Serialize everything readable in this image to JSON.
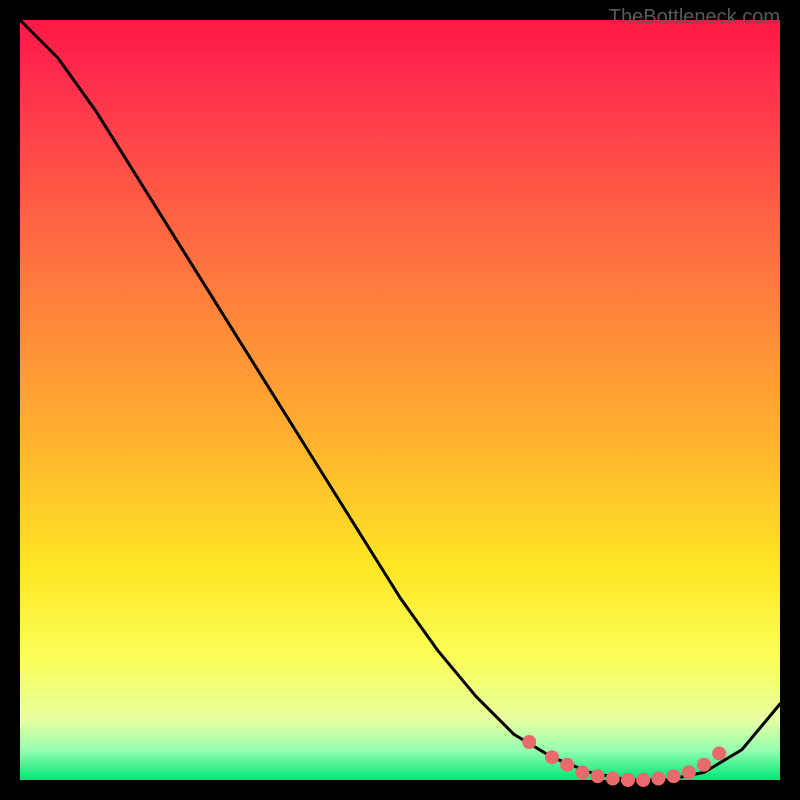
{
  "watermark": "TheBottleneck.com",
  "chart_data": {
    "type": "line",
    "title": "",
    "xlabel": "",
    "ylabel": "",
    "xlim": [
      0,
      100
    ],
    "ylim": [
      0,
      100
    ],
    "series": [
      {
        "name": "bottleneck-curve",
        "x": [
          0,
          5,
          10,
          15,
          20,
          25,
          30,
          35,
          40,
          45,
          50,
          55,
          60,
          65,
          70,
          75,
          80,
          85,
          90,
          95,
          100
        ],
        "values": [
          100,
          95,
          88,
          80,
          72,
          64,
          56,
          48,
          40,
          32,
          24,
          17,
          11,
          6,
          3,
          1,
          0,
          0,
          1,
          4,
          10
        ]
      }
    ],
    "markers": {
      "name": "optimal-range-dots",
      "x": [
        67,
        70,
        72,
        74,
        76,
        78,
        80,
        82,
        84,
        86,
        88,
        90,
        92
      ],
      "values": [
        5,
        3,
        2,
        1,
        0.5,
        0.2,
        0,
        0,
        0.2,
        0.5,
        1,
        2,
        3.5
      ],
      "color": "#e86a6a"
    },
    "gradient_stops": [
      {
        "pct": 0,
        "color": "#ff1744"
      },
      {
        "pct": 8,
        "color": "#ff2e4d"
      },
      {
        "pct": 20,
        "color": "#ff5147"
      },
      {
        "pct": 35,
        "color": "#ff7b3e"
      },
      {
        "pct": 55,
        "color": "#ffb12e"
      },
      {
        "pct": 72,
        "color": "#ffe624"
      },
      {
        "pct": 84,
        "color": "#fbff58"
      },
      {
        "pct": 92,
        "color": "#e8ffa0"
      },
      {
        "pct": 96,
        "color": "#98ffb0"
      },
      {
        "pct": 100,
        "color": "#00e676"
      }
    ]
  }
}
